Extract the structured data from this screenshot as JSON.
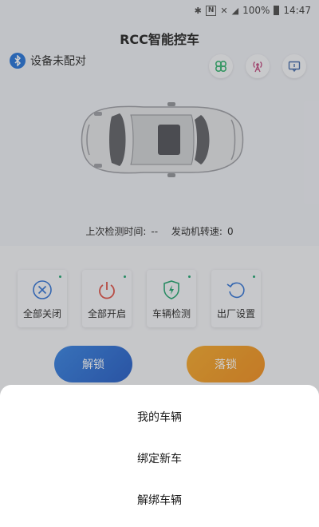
{
  "status_bar": {
    "battery": "100%",
    "time": "14:47",
    "nfc": "N"
  },
  "app": {
    "title": "RCC智能控车"
  },
  "bluetooth": {
    "status_text": "设备未配对",
    "icon": "bluetooth-icon"
  },
  "top_actions": [
    {
      "name": "clover-icon",
      "color": "#2fb36d"
    },
    {
      "name": "antenna-icon",
      "color": "#c0427b"
    },
    {
      "name": "message-icon",
      "color": "#3b64a8"
    }
  ],
  "info": {
    "last_check_label": "上次检测时间:",
    "last_check_value": "--",
    "rpm_label": "发动机转速:",
    "rpm_value": "0"
  },
  "tiles": [
    {
      "label": "全部关闭",
      "icon": "close-circle-icon",
      "color": "#2a6fd6"
    },
    {
      "label": "全部开启",
      "icon": "power-icon",
      "color": "#e04a3f"
    },
    {
      "label": "车辆检测",
      "icon": "shield-bolt-icon",
      "color": "#1aa36b"
    },
    {
      "label": "出厂设置",
      "icon": "reset-icon",
      "color": "#2a6fd6"
    }
  ],
  "buttons": {
    "unlock": "解锁",
    "lock": "落锁"
  },
  "sheet": {
    "items": [
      "我的车辆",
      "绑定新车",
      "解绑车辆"
    ]
  }
}
